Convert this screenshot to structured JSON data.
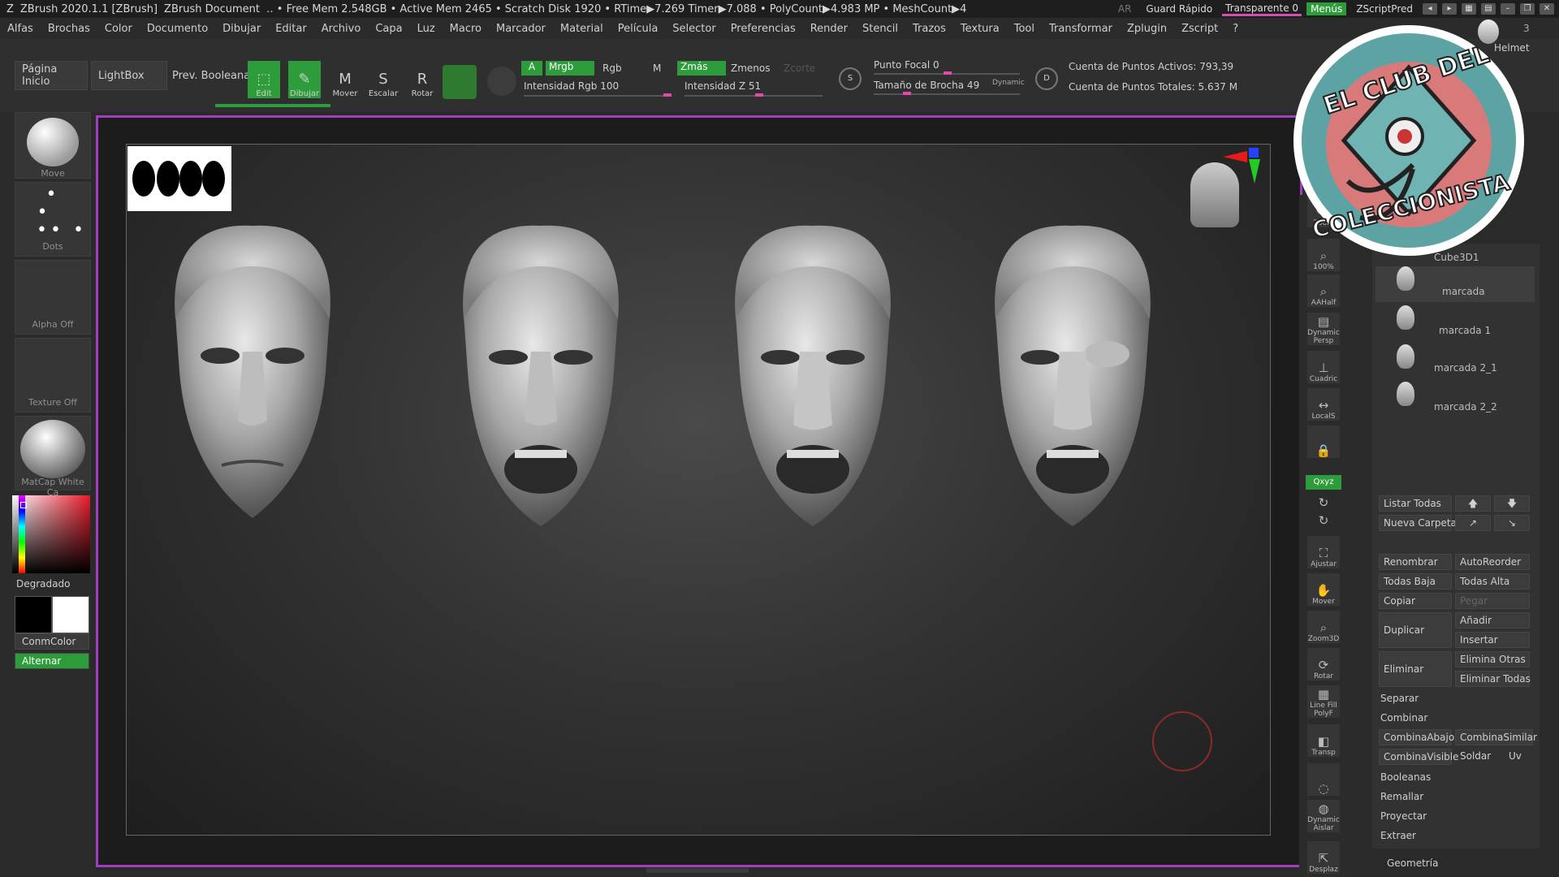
{
  "titlebar": {
    "app": "ZBrush 2020.1.1 [ZBrush]",
    "document": "ZBrush Document",
    "stats": "‥ • Free Mem 2.548GB • Active Mem 2465 • Scratch Disk 1920 •  RTime▶7.269 Timer▶7.088 • PolyCount▶4.983 MP  • MeshCount▶4",
    "ar": "AR",
    "quick_save": "Guard Rápido",
    "transparent": "Transparente 0",
    "menus": "Menús",
    "script": "ZScriptPred"
  },
  "menu": [
    "Alfas",
    "Brochas",
    "Color",
    "Documento",
    "Dibujar",
    "Editar",
    "Archivo",
    "Capa",
    "Luz",
    "Macro",
    "Marcador",
    "Material",
    "Película",
    "Selector",
    "Preferencias",
    "Render",
    "Stencil",
    "Trazos",
    "Textura",
    "Tool",
    "Transformar",
    "Zplugin",
    "Zscript",
    "?"
  ],
  "toolbar": {
    "home": "Página Inicio",
    "lightbox": "LightBox",
    "boolean": "Prev. Booleana",
    "edit": "Edit",
    "draw": "Dibujar",
    "move": "Mover",
    "scale": "Escalar",
    "rotate": "Rotar",
    "a": "A",
    "mrgb": "Mrgb",
    "rgb": "Rgb",
    "m": "M",
    "rgb_intensity": "Intensidad Rgb 100",
    "zadd": "Zmás",
    "zsub": "Zmenos",
    "zcut": "Zcorte",
    "z_intensity": "Intensidad Z 51",
    "focal": "Punto Focal 0",
    "brush_size": "Tamaño de Brocha 49",
    "dynamic": "Dynamic",
    "active_points": "Cuenta de Puntos Activos: 793,39",
    "total_points": "Cuenta de Puntos Totales: 5.637 M",
    "rgb_intensity_value": 1.0,
    "z_intensity_value": 0.51
  },
  "left": {
    "brush": "Move",
    "stroke": "Dots",
    "alpha": "Alpha Off",
    "texture": "Texture Off",
    "material": "MatCap White Ca",
    "gradient": "Degradado",
    "switch_color": "ConmColor",
    "alternate": "Alternar"
  },
  "rightcol": [
    "Zoom",
    "100%",
    "AAHalf",
    "Dynamic Persp",
    "Cuadric",
    "LocalS",
    "",
    "Qxyz",
    "",
    "",
    "Ajustar",
    "Mover",
    "Zoom3D",
    "Rotar",
    "Line Fill PolyF",
    "Transp",
    "",
    "Dynamic Aislar",
    "Desplaz"
  ],
  "subtool": {
    "header": "Helmet",
    "counter": "3",
    "top_item": "Cube3D1",
    "items": [
      "marcada",
      "marcada 1",
      "marcada 2_1",
      "marcada 2_2"
    ],
    "buttons": {
      "list_all": "Listar Todas",
      "new_folder": "Nueva Carpeta",
      "rename": "Renombrar",
      "autoreorder": "AutoReorder",
      "all_low": "Todas Baja",
      "all_high": "Todas Alta",
      "copy": "Copiar",
      "paste": "Pegar",
      "duplicate": "Duplicar",
      "add": "Añadir",
      "insert": "Insertar",
      "delete": "Eliminar",
      "delete_other": "Elimina Otras",
      "delete_all": "Eliminar Todas",
      "split": "Separar",
      "merge": "Combinar",
      "merge_down": "CombinaAbajo",
      "merge_similar": "CombinaSimilar",
      "merge_visible": "CombinaVisible",
      "weld": "Soldar",
      "uv": "Uv",
      "boolean": "Booleanas",
      "remesh": "Remallar",
      "project": "Proyectar",
      "extract": "Extraer",
      "geometry": "Geometría"
    }
  },
  "logo": {
    "line1": "EL CLUB DEL",
    "line2": "COLECCIONISTA",
    "bg": "#d97a7a",
    "ring": "#5ea3a4"
  },
  "colors": {
    "accent_green": "#2d9c3a",
    "frame_purple": "#a23dc0",
    "slider_pink": "#e04ab0"
  }
}
